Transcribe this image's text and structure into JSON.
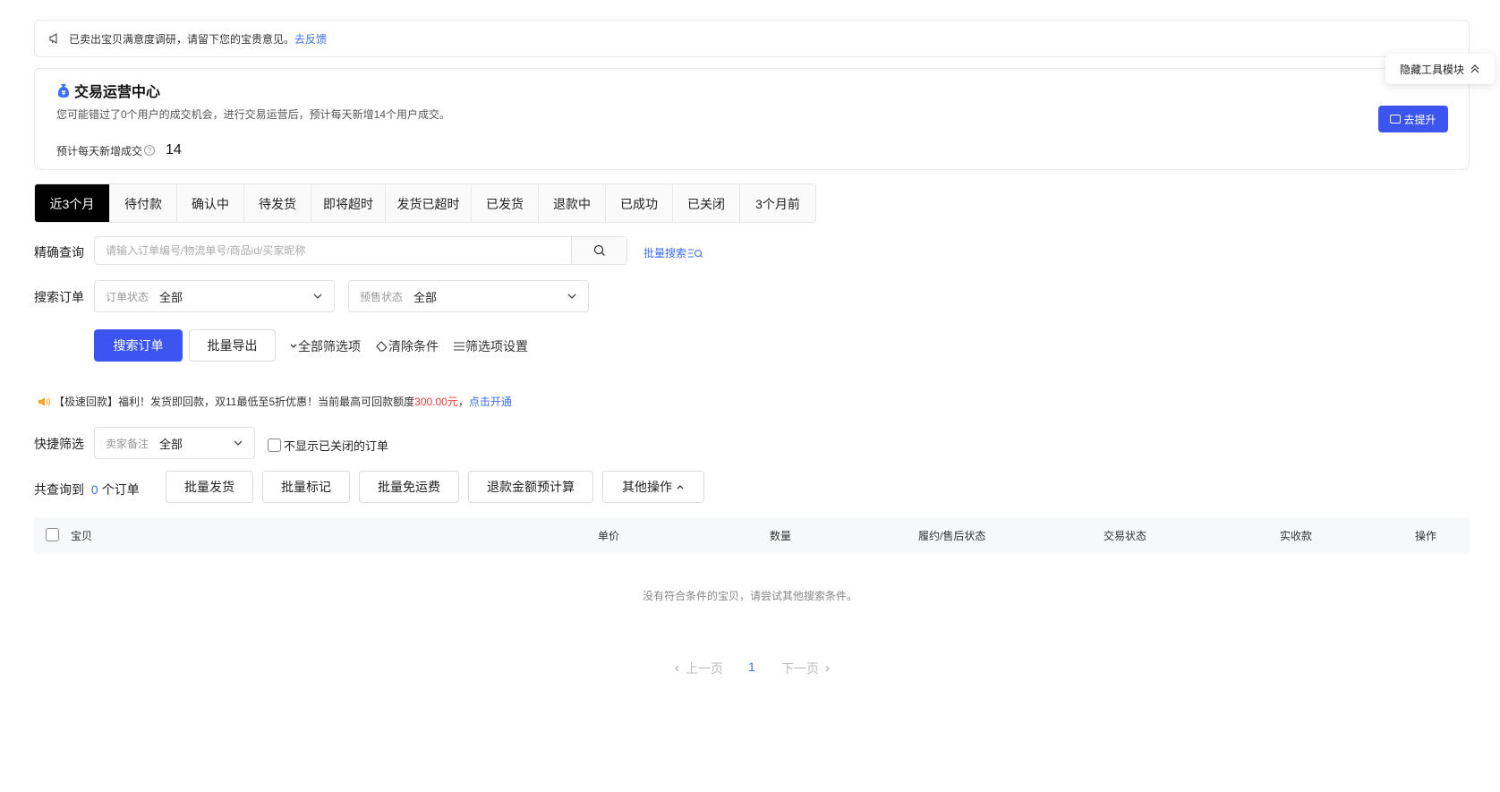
{
  "notice": {
    "text": "已卖出宝贝满意度调研，请留下您的宝贵意见。",
    "link": "去反馈"
  },
  "op_center": {
    "title": "交易运营中心",
    "desc": "您可能错过了0个用户的成交机会，进行交易运营后，预计每天新增14个用户成交。",
    "stat_label": "预计每天新增成交",
    "stat_value": "14",
    "button": "去提升"
  },
  "hide_tools": "隐藏工具模块",
  "tabs": [
    {
      "label": "近3个月",
      "active": true
    },
    {
      "label": "待付款"
    },
    {
      "label": "确认中"
    },
    {
      "label": "待发货"
    },
    {
      "label": "即将超时"
    },
    {
      "label": "发货已超时"
    },
    {
      "label": "已发货"
    },
    {
      "label": "退款中"
    },
    {
      "label": "已成功"
    },
    {
      "label": "已关闭"
    },
    {
      "label": "3个月前"
    }
  ],
  "precise": {
    "label": "精确查询",
    "placeholder": "请输入订单编号/物流单号/商品id/买家昵称",
    "batch_search": "批量搜索"
  },
  "search_order": {
    "label": "搜索订单",
    "order_status_key": "订单状态",
    "order_status_value": "全部",
    "presale_key": "预售状态",
    "presale_value": "全部"
  },
  "actions": {
    "search": "搜索订单",
    "export": "批量导出",
    "all_filters": "全部筛选项",
    "clear": "清除条件",
    "filter_settings": "筛选项设置"
  },
  "promo": {
    "text1": "【极速回款】福利！发货即回款，双11最低至5折优惠！当前最高可回款额度",
    "amount": "300.00元",
    "sep": "，",
    "link": "点击开通"
  },
  "quick": {
    "label": "快捷筛选",
    "remark_key": "卖家备注",
    "remark_value": "全部",
    "hide_closed": "不显示已关闭的订单"
  },
  "result": {
    "prefix": "共查询到",
    "count": "0",
    "suffix": "个订单",
    "buttons": [
      "批量发货",
      "批量标记",
      "批量免运费",
      "退款金额预计算",
      "其他操作"
    ]
  },
  "table": {
    "columns": [
      "宝贝",
      "单价",
      "数量",
      "履约/售后状态",
      "交易状态",
      "实收款",
      "操作"
    ]
  },
  "empty": "没有符合条件的宝贝，请尝试其他搜索条件。",
  "pager": {
    "prev": "上一页",
    "page": "1",
    "next": "下一页"
  },
  "colors": {
    "primary": "#3d55f0",
    "link": "#3d6ef5",
    "accent_red": "#f03c3c"
  }
}
